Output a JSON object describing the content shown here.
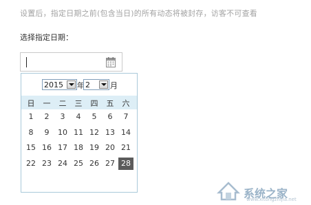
{
  "notice": "设置后，指定日期之前(包含当日)的所有动态将被封存，访客不可查看",
  "label": "选择指定日期：",
  "date_input": {
    "value": "",
    "icon": "calendar-icon"
  },
  "picker": {
    "year": "2015",
    "year_unit": "年",
    "month": "2",
    "month_unit": "月",
    "weekdays": [
      "日",
      "一",
      "二",
      "三",
      "四",
      "五",
      "六"
    ],
    "weeks": [
      [
        "1",
        "2",
        "3",
        "4",
        "5",
        "6",
        "7"
      ],
      [
        "8",
        "9",
        "10",
        "11",
        "12",
        "13",
        "14"
      ],
      [
        "15",
        "16",
        "17",
        "18",
        "19",
        "20",
        "21"
      ],
      [
        "22",
        "23",
        "24",
        "25",
        "26",
        "27",
        "28"
      ]
    ],
    "selected_day": "28"
  },
  "watermark": {
    "text": "系统之家",
    "url": "www.xitongzhijia.net"
  },
  "colors": {
    "weekday_header_bg": "#ddeef6",
    "selected_bg": "#5b5b5b",
    "picker_border": "#a9c9d9"
  }
}
